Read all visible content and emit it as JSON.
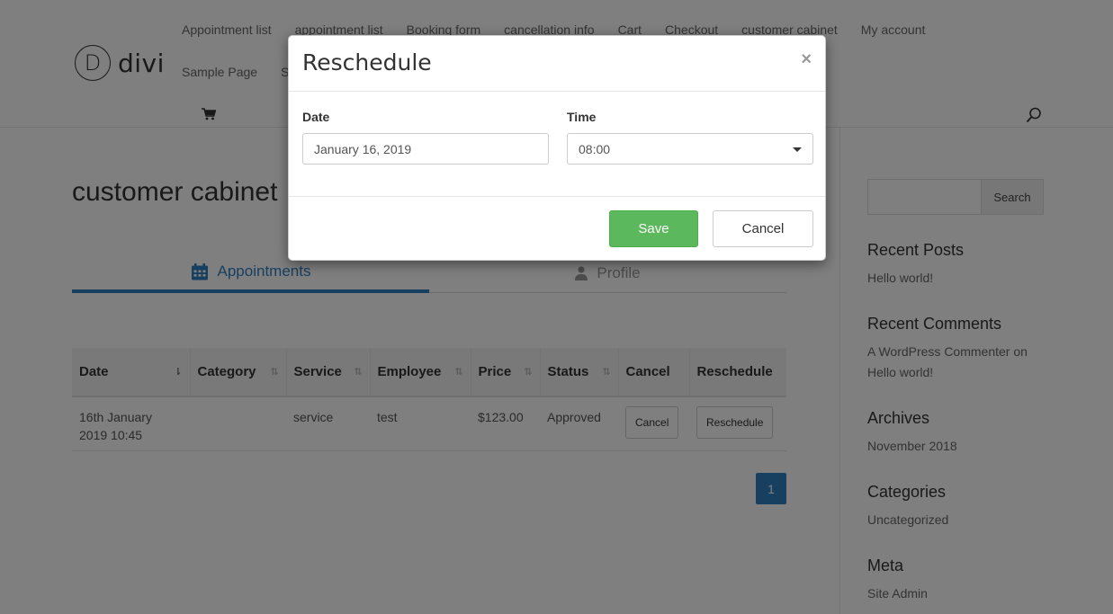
{
  "site": {
    "logo_letter": "D",
    "logo_text": "divi"
  },
  "nav": {
    "row1": [
      "Appointment list",
      "appointment list",
      "Booking form",
      "cancellation info",
      "Cart",
      "Checkout",
      "customer cabinet",
      "My account"
    ],
    "row2": [
      "Sample Page",
      "S"
    ]
  },
  "page": {
    "title": "customer cabinet"
  },
  "tabs": [
    {
      "label": "Appointments",
      "icon": "calendar-icon",
      "active": true
    },
    {
      "label": "Profile",
      "icon": "user-icon",
      "active": false
    }
  ],
  "table": {
    "columns": [
      "Date",
      "Category",
      "Service",
      "Employee",
      "Price",
      "Status",
      "Cancel",
      "Reschedule"
    ],
    "rows": [
      {
        "date": "16th January 2019 10:45",
        "category": "",
        "service": "service",
        "employee": "test",
        "price": "$123.00",
        "status": "Approved",
        "cancel_label": "Cancel",
        "reschedule_label": "Reschedule"
      }
    ]
  },
  "pagination": {
    "current": "1"
  },
  "sidebar": {
    "search_button": "Search",
    "recent_posts_title": "Recent Posts",
    "recent_posts": [
      "Hello world!"
    ],
    "recent_comments_title": "Recent Comments",
    "recent_comment": "A WordPress Commenter on Hello world!",
    "archives_title": "Archives",
    "archives": [
      "November 2018"
    ],
    "categories_title": "Categories",
    "categories": [
      "Uncategorized"
    ],
    "meta_title": "Meta",
    "meta": [
      "Site Admin"
    ]
  },
  "modal": {
    "title": "Reschedule",
    "close": "×",
    "date_label": "Date",
    "date_value": "January 16, 2019",
    "time_label": "Time",
    "time_value": "08:00",
    "save_label": "Save",
    "cancel_label": "Cancel"
  },
  "colors": {
    "accent": "#2f7fc1",
    "save": "#5cb85c"
  }
}
